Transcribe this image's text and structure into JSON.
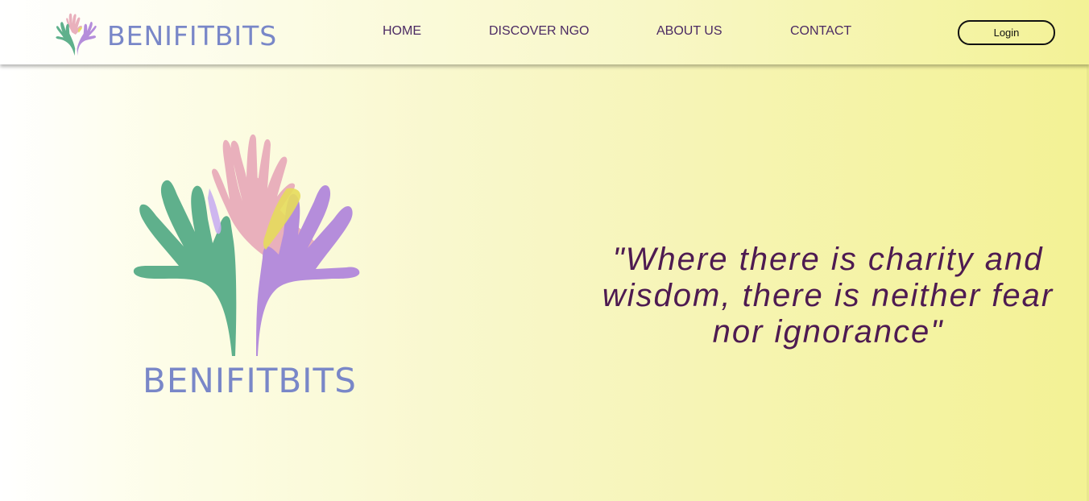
{
  "brand": {
    "name": "BENIFITBITS",
    "logo_icon": "helping-hands-icon"
  },
  "nav": {
    "items": [
      {
        "label": "HOME"
      },
      {
        "label": "DISCOVER NGO"
      },
      {
        "label": "ABOUT US"
      },
      {
        "label": "CONTACT"
      }
    ],
    "login_label": "Login"
  },
  "hero": {
    "brand_name": "BENIFITBITS",
    "quote": "\"Where there is charity and wisdom, there is neither fear nor ignorance\""
  },
  "colors": {
    "brand_text": "#7987c8",
    "nav_text": "#4b2a63",
    "quote_text": "#4e1b51",
    "hand_green": "#5fb08c",
    "hand_pink": "#e9b0bc",
    "hand_purple": "#b58ddb",
    "hand_yellow": "#e5dc5b",
    "background_end": "#f3f294"
  }
}
